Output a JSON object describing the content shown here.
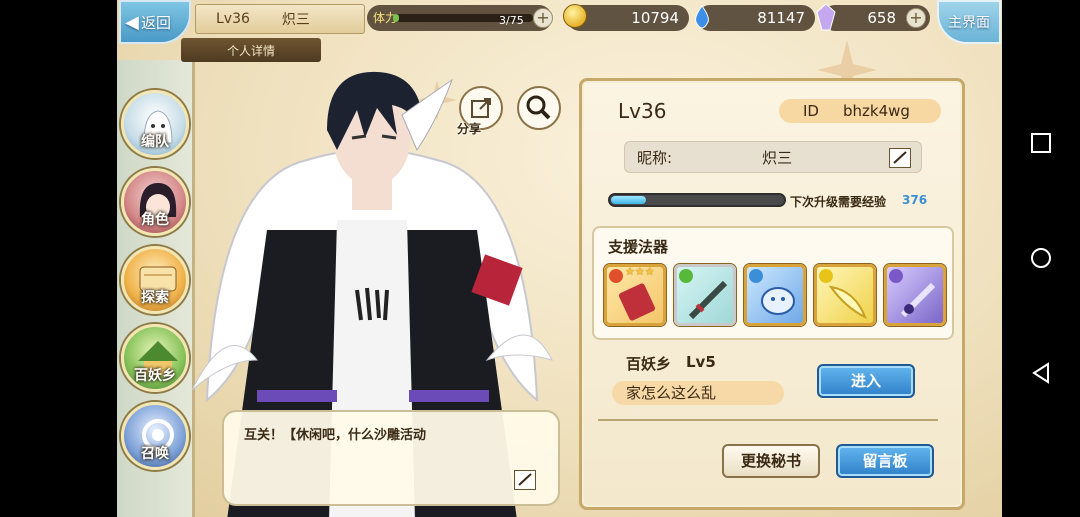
{
  "topbar": {
    "back_label": "返回",
    "level": "Lv36",
    "name": "炽三",
    "detail_tab": "个人详情",
    "stamina_label": "体力",
    "stamina_value": "3/75",
    "stamina_fraction": 0.04,
    "gold": "10794",
    "gems": "81147",
    "crystals": "658",
    "home_label": "主界面"
  },
  "sidebar": {
    "items": [
      {
        "label": "编队"
      },
      {
        "label": "角色"
      },
      {
        "label": "探索"
      },
      {
        "label": "百妖乡"
      },
      {
        "label": "召唤"
      }
    ]
  },
  "actions": {
    "share_label": "分享"
  },
  "bubble": {
    "text": "互关！【休闲吧，什么沙雕活动"
  },
  "panel": {
    "level": "Lv36",
    "id_key": "ID",
    "id_value": "bhzk4wg",
    "nick_key": "昵称:",
    "nick_value": "炽三",
    "exp_label": "下次升级需要经验",
    "exp_value": "376",
    "exp_fraction": 0.2,
    "support_title": "支援法器",
    "guild_name": "百妖乡",
    "guild_level": "Lv5",
    "guild_motto": "家怎么这么乱",
    "enter_label": "进入",
    "swap_label": "更换秘书",
    "message_label": "留言板"
  },
  "weapons": [
    {
      "stars": "★★★",
      "elem_color": "#e0502a",
      "icon": "scroll-weapon-icon"
    },
    {
      "stars": "",
      "elem_color": "#58b83a",
      "icon": "sword-weapon-icon"
    },
    {
      "stars": "",
      "elem_color": "#3a8fd8",
      "icon": "beast-weapon-icon"
    },
    {
      "stars": "",
      "elem_color": "#e8c41a",
      "icon": "wing-weapon-icon"
    },
    {
      "stars": "",
      "elem_color": "#7a58c8",
      "icon": "blade-weapon-icon"
    }
  ],
  "colors": {
    "accent_blue": "#2f7fc8",
    "gold_frame": "#c6a868"
  }
}
